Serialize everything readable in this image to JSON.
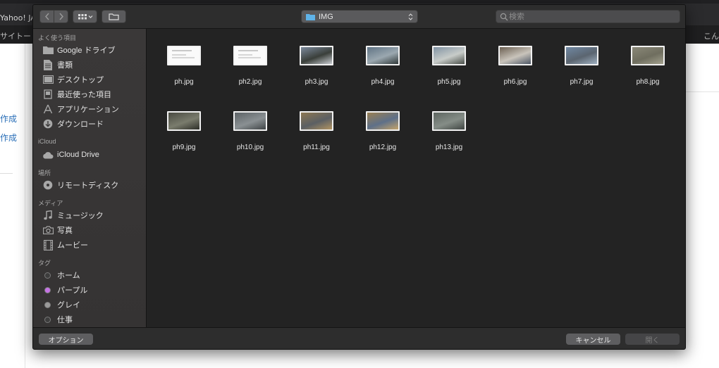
{
  "background": {
    "tab_title": "Yahoo! JAP",
    "nav_left": "サイトー",
    "nav_right": "こん",
    "link_1": "作成",
    "link_2": "作成"
  },
  "toolbar": {
    "back_icon": "chevron-left-icon",
    "forward_icon": "chevron-right-icon",
    "view_icon": "grid-view-icon",
    "new_folder_icon": "new-folder-icon",
    "path": "IMG",
    "search_placeholder": "検索",
    "search_value": ""
  },
  "sidebar": {
    "favorites_header": "よく使う項目",
    "favorites": [
      {
        "label": "Google ドライブ",
        "icon": "folder-icon"
      },
      {
        "label": "書類",
        "icon": "document-icon"
      },
      {
        "label": "デスクトップ",
        "icon": "desktop-icon"
      },
      {
        "label": "最近使った項目",
        "icon": "recents-icon"
      },
      {
        "label": "アプリケーション",
        "icon": "applications-icon"
      },
      {
        "label": "ダウンロード",
        "icon": "download-icon"
      }
    ],
    "icloud_header": "iCloud",
    "icloud": [
      {
        "label": "iCloud Drive",
        "icon": "cloud-icon"
      }
    ],
    "locations_header": "場所",
    "locations": [
      {
        "label": "リモートディスク",
        "icon": "disc-icon"
      }
    ],
    "media_header": "メディア",
    "media": [
      {
        "label": "ミュージック",
        "icon": "music-icon"
      },
      {
        "label": "写真",
        "icon": "camera-icon"
      },
      {
        "label": "ムービー",
        "icon": "film-icon"
      }
    ],
    "tags_header": "タグ",
    "tags": [
      {
        "label": "ホーム",
        "color": "#3d3d3d"
      },
      {
        "label": "パープル",
        "color": "#c673e6"
      },
      {
        "label": "グレイ",
        "color": "#9a9a9a"
      },
      {
        "label": "仕事",
        "color": "#3d3d3d"
      }
    ]
  },
  "files": [
    {
      "name": "ph.jpg",
      "thumb": "document"
    },
    {
      "name": "ph2.jpg",
      "thumb": "document"
    },
    {
      "name": "ph3.jpg",
      "thumb": "photo",
      "colors": [
        "#7c8a9c",
        "#3a3f3a",
        "#c9cdd2"
      ]
    },
    {
      "name": "ph4.jpg",
      "thumb": "photo",
      "colors": [
        "#5f7384",
        "#9ba8b0",
        "#2f3838"
      ]
    },
    {
      "name": "ph5.jpg",
      "thumb": "photo",
      "colors": [
        "#8193a3",
        "#c8ccc9",
        "#4a4f49"
      ]
    },
    {
      "name": "ph6.jpg",
      "thumb": "photo",
      "colors": [
        "#6c6052",
        "#c9c4bb",
        "#4c5664"
      ]
    },
    {
      "name": "ph7.jpg",
      "thumb": "photo",
      "colors": [
        "#7088a3",
        "#5b6570",
        "#9fb0c0"
      ]
    },
    {
      "name": "ph8.jpg",
      "thumb": "photo",
      "colors": [
        "#8a8878",
        "#6f6e5f",
        "#a3a18e"
      ]
    },
    {
      "name": "ph9.jpg",
      "thumb": "photo",
      "colors": [
        "#4a4b42",
        "#7a7c6d",
        "#2d2e28"
      ]
    },
    {
      "name": "ph10.jpg",
      "thumb": "photo",
      "colors": [
        "#5d6366",
        "#8a9093",
        "#3f4446"
      ]
    },
    {
      "name": "ph11.jpg",
      "thumb": "photo",
      "colors": [
        "#8c7752",
        "#5b5f63",
        "#b29462"
      ]
    },
    {
      "name": "ph12.jpg",
      "thumb": "photo",
      "colors": [
        "#9a8053",
        "#5e7089",
        "#c5a46b"
      ]
    },
    {
      "name": "ph13.jpg",
      "thumb": "photo",
      "colors": [
        "#5e6661",
        "#858d87",
        "#3f4542"
      ]
    }
  ],
  "bottombar": {
    "options_label": "オプション",
    "cancel_label": "キャンセル",
    "open_label": "開く"
  }
}
